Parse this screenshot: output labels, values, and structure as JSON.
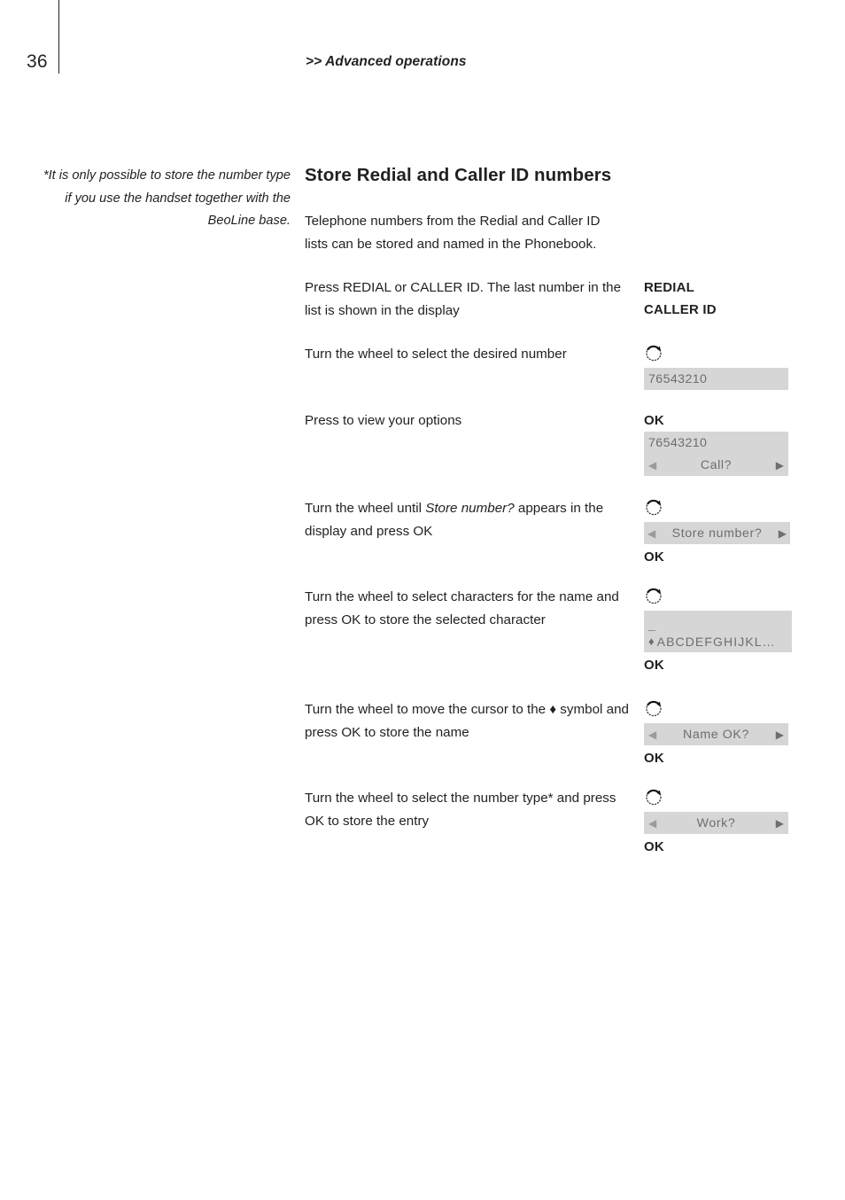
{
  "page": {
    "number": "36",
    "section": ">> Advanced operations"
  },
  "footnote": {
    "text": "*It is only possible to store the number type if you use the handset together with the BeoLine base."
  },
  "content": {
    "heading": "Store Redial and Caller ID numbers",
    "intro": "Telephone numbers from the Redial and Caller ID lists can be stored and named in the Phonebook."
  },
  "icons": {
    "wheel": "turn-wheel-icon",
    "arrow_left": "◀",
    "arrow_right": "▶",
    "diamond": "♦",
    "cursor": "_"
  },
  "colors": {
    "text": "#231f20",
    "display_background": "#d6d6d6",
    "display_text": "#6e6e6e",
    "arrow_dim": "#9a9a9a"
  },
  "steps": [
    {
      "id": "press-redial-or-caller-id",
      "instruction_html": "Press REDIAL or CALLER ID. The last number in the list is shown in the display",
      "keys": [
        "REDIAL",
        "CALLER ID"
      ]
    },
    {
      "id": "turn-wheel-select-number",
      "instruction_html": "Turn the wheel to select the desired number",
      "display_number": "76543210"
    },
    {
      "id": "press-to-view-options",
      "instruction_html": "Press to view your options",
      "key": "OK",
      "display_number": "76543210",
      "display_option": "Call?"
    },
    {
      "id": "turn-wheel-store-number",
      "instruction_html": "Turn the wheel until <i>Store number?</i> appears in the display and press OK",
      "display_option": "Store number?",
      "key_after": "OK"
    },
    {
      "id": "select-characters-for-name",
      "instruction_html": "Turn the wheel to select characters for the name and press OK to store the selected character",
      "display_cursor": "_",
      "display_alphabet": "ABCDEFGHIJKL…",
      "key_after": "OK"
    },
    {
      "id": "move-cursor-to-diamond",
      "instruction_html": "Turn the wheel to move the cursor to the <span class=\"diamond-inline\">♦</span> symbol and press OK to store the name",
      "display_option": "Name OK?",
      "key_after": "OK"
    },
    {
      "id": "select-number-type",
      "instruction_html": "Turn the wheel to select the number type* and press OK to store the entry",
      "display_option": "Work?",
      "key_after": "OK"
    }
  ]
}
